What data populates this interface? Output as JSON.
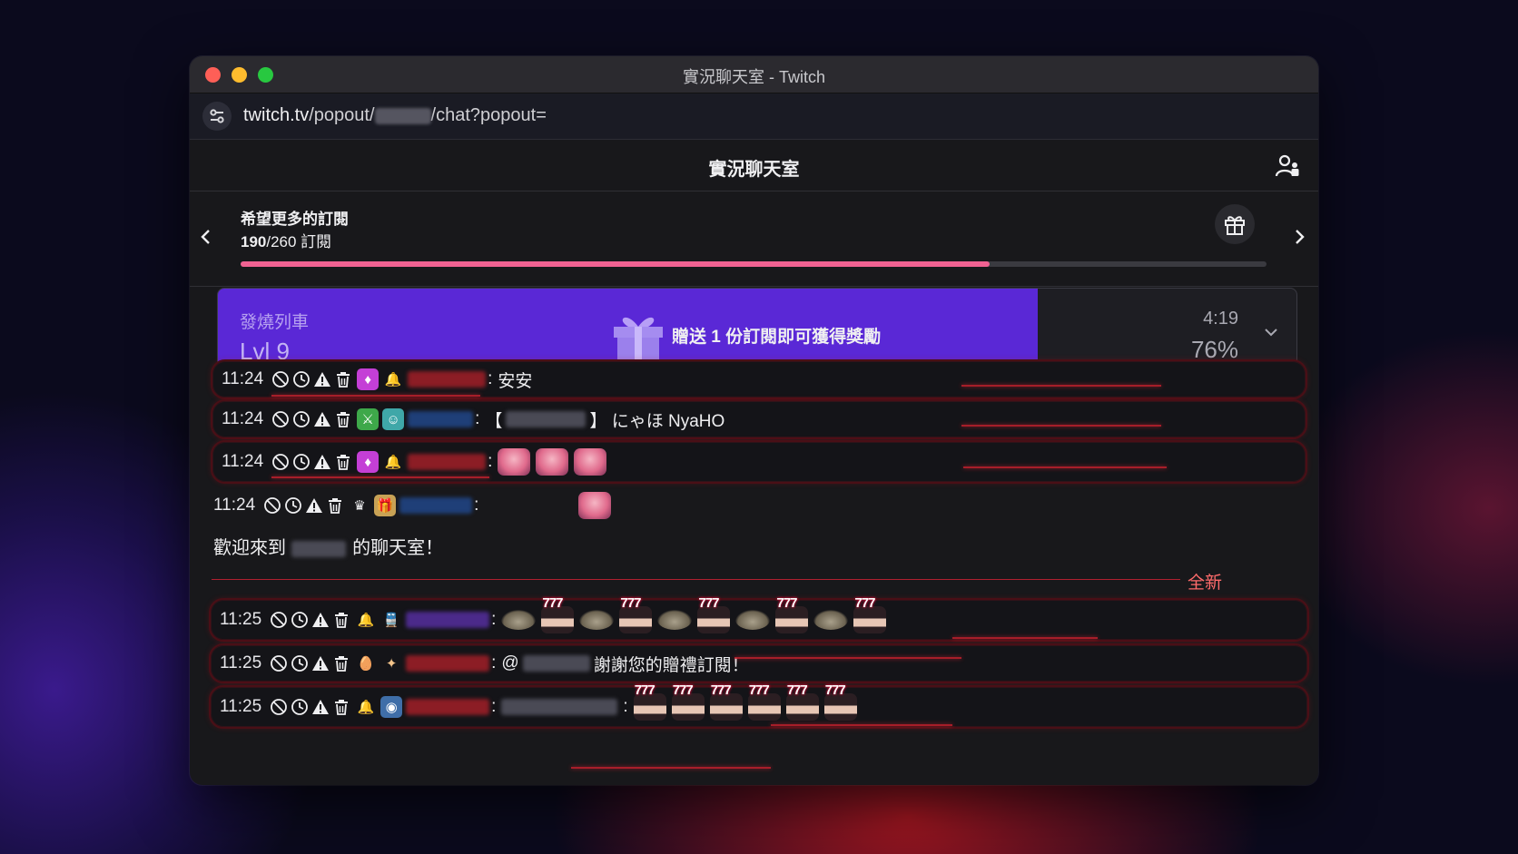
{
  "window": {
    "title": "實況聊天室 - Twitch",
    "url_host": "twitch.tv",
    "url_path_start": "/popout/",
    "url_path_end": "/chat?popout="
  },
  "header": {
    "title": "實況聊天室",
    "icon": "community-icon"
  },
  "goal": {
    "title": "希望更多的訂閱",
    "current": "190",
    "total_text": "/260 訂閱",
    "progress": 0.73,
    "progress_color": "#f06292"
  },
  "hype_train": {
    "label": "發燒列車",
    "level": "Lvl 9",
    "message": "贈送 1 份訂閱即可獲得獎勵",
    "time": "4:19",
    "percent": "76%",
    "progress": 0.76,
    "color": "#5a28d6"
  },
  "messages": [
    {
      "time": "11:24",
      "text": "安安"
    },
    {
      "time": "11:24",
      "text_open": "【",
      "text_close": "】 にゃほ NyaHO"
    },
    {
      "time": "11:24",
      "text": ""
    },
    {
      "time": "11:24",
      "text": ""
    },
    {
      "time": "11:25",
      "text": ""
    },
    {
      "time": "11:25",
      "text_before": "@",
      "text_after": "謝謝您的贈禮訂閱！"
    },
    {
      "time": "11:25",
      "text": ""
    }
  ],
  "welcome": {
    "before": "歡迎來到",
    "after": "的聊天室！"
  },
  "separator": {
    "label": "全新"
  },
  "colors": {
    "accent_purple": "#5a28d6",
    "pink": "#f06292",
    "alert_red": "#c0202d"
  }
}
